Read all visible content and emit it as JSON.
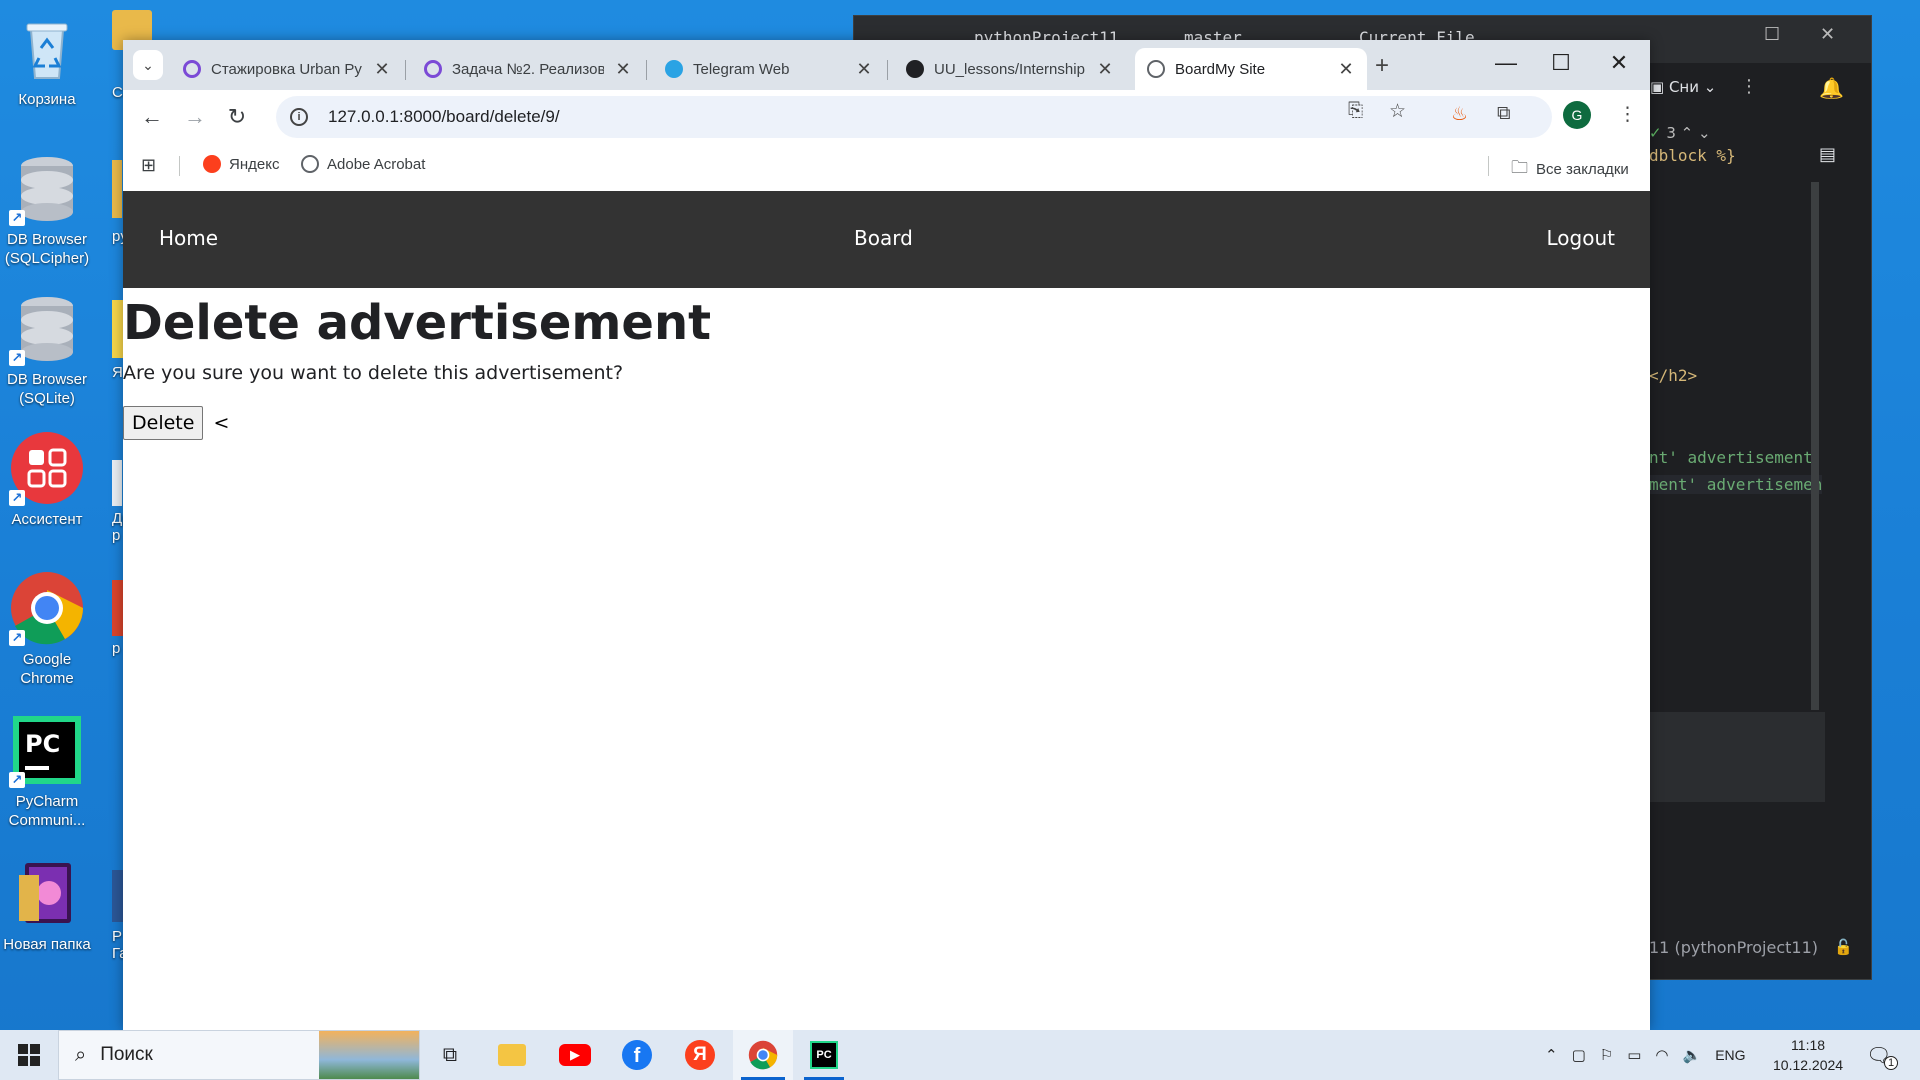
{
  "desktop": {
    "icons": [
      {
        "label": "Корзина"
      },
      {
        "label": "DB Browser (SQLCipher)"
      },
      {
        "label": "DB Browser (SQLite)"
      },
      {
        "label": "Ассистент"
      },
      {
        "label": "Google Chrome"
      },
      {
        "label": "PyCharm Communi..."
      },
      {
        "label": "Новая папка"
      }
    ],
    "partial_labels": [
      "Сай",
      "pyth",
      "Янд",
      "Ди р",
      "р",
      "Р Гал"
    ]
  },
  "ide": {
    "project": "pythonProject11",
    "branch": "master",
    "run_config": "Current File",
    "snip_label": "Сни",
    "code_lines": [
      "dblock %}",
      "</h2>",
      "nt' advertisement.",
      "ment' advertisemen"
    ],
    "check_count": "3",
    "status_text": "11 (pythonProject11)"
  },
  "browser": {
    "tabs": [
      {
        "title": "Стажировка Urban Ру",
        "favicon": "urban-icon"
      },
      {
        "title": "Задача №2. Реализов",
        "favicon": "urban-icon"
      },
      {
        "title": "Telegram Web",
        "favicon": "telegram-icon"
      },
      {
        "title": "UU_lessons/Internship",
        "favicon": "github-icon"
      },
      {
        "title": "BoardMy Site",
        "favicon": "globe-icon",
        "active": true
      }
    ],
    "url": "127.0.0.1:8000/board/delete/9/",
    "avatar_letter": "G",
    "bookmarks": [
      {
        "label": "Яндекс",
        "icon": "yandex-icon"
      },
      {
        "label": "Adobe Acrobat",
        "icon": "acrobat-icon"
      }
    ],
    "all_bookmarks_label": "Все закладки"
  },
  "site": {
    "nav": {
      "home": "Home",
      "board": "Board",
      "logout": "Logout"
    },
    "heading": "Delete advertisement",
    "question": "Are you sure you want to delete this advertisement?",
    "delete_button": "Delete",
    "back_link": "<"
  },
  "taskbar": {
    "search_placeholder": "Поиск",
    "language": "ENG",
    "time": "11:18",
    "date": "10.12.2024",
    "notification_count": "1"
  },
  "colors": {
    "desktop": "#1a7fd6",
    "site_nav": "#333333",
    "omnibox": "#edf2fa",
    "tabstrip": "#dde3ea"
  }
}
